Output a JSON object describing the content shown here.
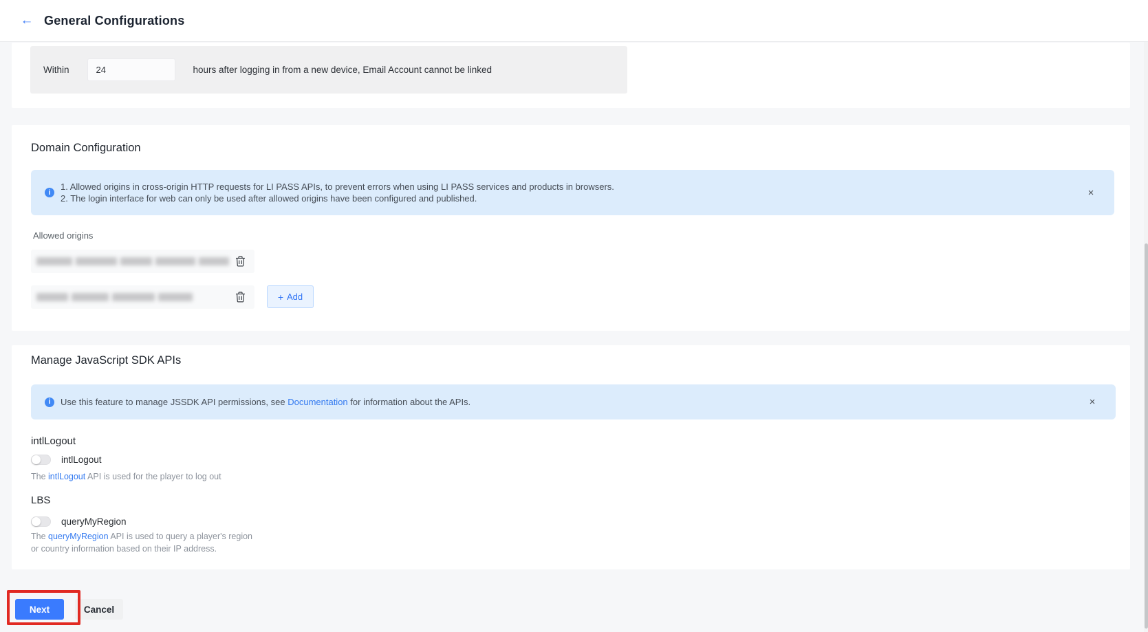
{
  "header": {
    "title": "General Configurations",
    "back_icon": "←"
  },
  "email_linking": {
    "within_label": "Within",
    "hours_value": "24",
    "suffix": "hours after logging in from a new device, Email Account cannot be linked"
  },
  "domain_config": {
    "title": "Domain Configuration",
    "banner": {
      "info_icon": "i",
      "line1": "1. Allowed origins in cross-origin HTTP requests for LI PASS APIs, to prevent errors when using LI PASS services and products in browsers.",
      "line2": "2. The login interface for web can only be used after allowed origins have been configured and published.",
      "close_icon": "×"
    },
    "allowed_origins_label": "Allowed origins",
    "origins": [
      {
        "redacted": true
      },
      {
        "redacted": true
      }
    ],
    "add_button": {
      "icon": "+",
      "label": "Add"
    }
  },
  "jssdk": {
    "title": "Manage JavaScript SDK APIs",
    "banner": {
      "info_icon": "i",
      "prefix": "Use this feature to manage JSSDK API permissions, see ",
      "link": "Documentation",
      "suffix": " for information about the APIs.",
      "close_icon": "×"
    },
    "groups": [
      {
        "title": "intlLogout",
        "toggle_label": "intlLogout",
        "toggle_state": "off",
        "desc_prefix": "The ",
        "desc_link": "intlLogout",
        "desc_suffix": " API is used for the player to log out"
      },
      {
        "title": "LBS",
        "toggle_label": "queryMyRegion",
        "toggle_state": "off",
        "desc_prefix": "The ",
        "desc_link": "queryMyRegion",
        "desc_suffix": " API is used to query a player's region or country information based on their IP address."
      }
    ]
  },
  "footer": {
    "next_label": "Next",
    "cancel_label": "Cancel"
  },
  "colors": {
    "accent_blue": "#3a7bfe",
    "link_blue": "#3279f0",
    "banner_bg": "#dcecfc",
    "info_icon_bg": "#4189f5",
    "annotation_red": "#e12a23",
    "page_bg": "#f6f7f9",
    "card_bg": "#ffffff"
  }
}
